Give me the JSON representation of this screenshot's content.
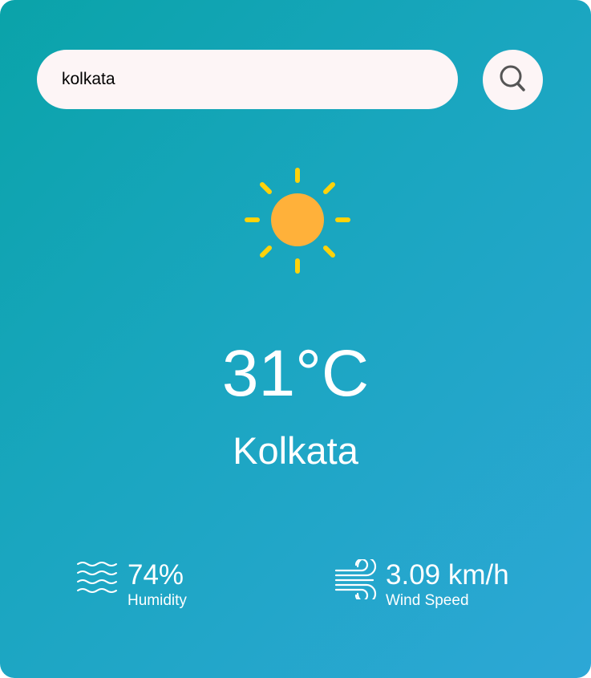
{
  "search": {
    "value": "kolkata"
  },
  "weather": {
    "icon": "sun-icon",
    "temperature": "31°C",
    "city": "Kolkata"
  },
  "details": {
    "humidity": {
      "icon": "humidity-waves-icon",
      "value": "74%",
      "label": "Humidity"
    },
    "wind": {
      "icon": "wind-icon",
      "value": "3.09 km/h",
      "label": "Wind Speed"
    }
  },
  "colors": {
    "gradient_start": "#0aa3a9",
    "gradient_end": "#2da7d6",
    "sun_core": "#ffb13a",
    "sun_rays": "#ffd20a"
  }
}
